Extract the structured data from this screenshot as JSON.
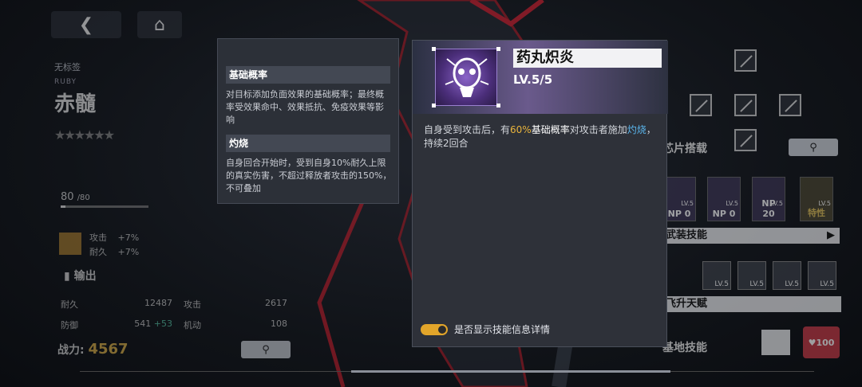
{
  "left": {
    "back_icon": "back-arrow-icon",
    "home_icon": "home-icon",
    "tag": "无标签",
    "code": "RUBY",
    "name": "赤髓",
    "stars": "★★★★★★",
    "level": "80",
    "level_max": "/80",
    "exp_ratio": 0.05,
    "bonus_atk_label": "攻击",
    "bonus_atk": "+7%",
    "bonus_hp_label": "耐久",
    "bonus_hp": "+7%",
    "output_label": "输出",
    "stats": [
      {
        "label": "耐久",
        "value": "12487"
      },
      {
        "label": "攻击",
        "value": "2617"
      },
      {
        "label": "防御",
        "value": "541",
        "bonus": "+53"
      },
      {
        "label": "机动",
        "value": "108"
      }
    ],
    "power_label": "战力:",
    "power_value": "4567"
  },
  "tooltip": {
    "section1_title": "基础概率",
    "section1_text": "对目标添加负面效果的基础概率；最终概率受效果命中、效果抵抗、免疫效果等影响",
    "section2_title": "灼烧",
    "section2_text": "自身回合开始时，受到自身10%耐久上限的真实伤害，不超过释放者攻击的150%，不可叠加"
  },
  "skill": {
    "name": "药丸炽炎",
    "level": "LV.5/5",
    "desc_pre": "自身受到攻击后，有",
    "desc_pct": "60%",
    "desc_mid": "基础概率",
    "desc_mid2": "对攻击者施加",
    "desc_kw": "灼烧",
    "desc_post": "，持续2回合",
    "toggle_label": "是否显示技能信息详情",
    "toggle_on": true
  },
  "right": {
    "chip_label": "芯片搭载",
    "skills_label": "武装技能",
    "np_cards": [
      {
        "np": "NP 0",
        "lv": "LV.5"
      },
      {
        "np": "NP 0",
        "lv": "LV.5"
      },
      {
        "np": "NP 20",
        "lv": "LV.5"
      },
      {
        "np": "特性",
        "lv": "LV.5"
      }
    ],
    "talent_label": "飞升天赋",
    "talent_lv": [
      "LV.5",
      "LV.5",
      "LV.5",
      "LV.5"
    ],
    "base_label": "基地技能",
    "base_value": "100"
  }
}
